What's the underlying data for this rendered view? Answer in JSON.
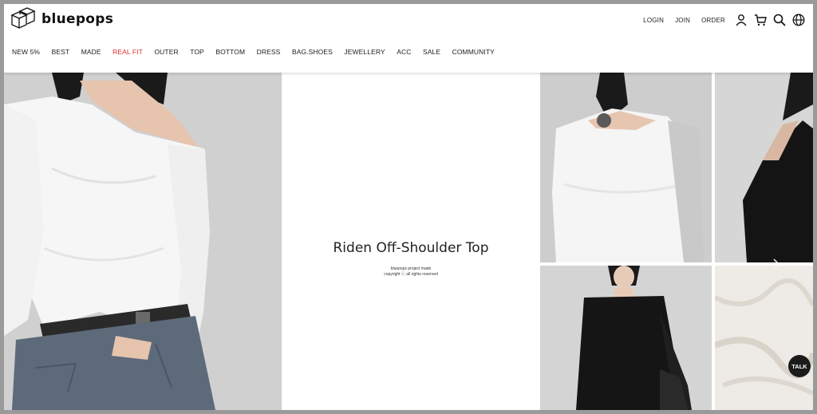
{
  "brand": {
    "name": "bluepops",
    "logo_icon": "cube-logo-icon"
  },
  "top_links": [
    "LOGIN",
    "JOIN",
    "ORDER"
  ],
  "top_icons": [
    "user-icon",
    "cart-icon",
    "search-icon",
    "globe-icon"
  ],
  "main_nav": [
    {
      "label": "NEW 5%"
    },
    {
      "label": "BEST"
    },
    {
      "label": "MADE"
    },
    {
      "label": "REAL FIT",
      "color": "#e03030"
    },
    {
      "label": "OUTER"
    },
    {
      "label": "TOP"
    },
    {
      "label": "BOTTOM"
    },
    {
      "label": "DRESS"
    },
    {
      "label": "BAG.SHOES"
    },
    {
      "label": "JEWELLERY"
    },
    {
      "label": "ACC"
    },
    {
      "label": "SALE"
    },
    {
      "label": "COMMUNITY"
    }
  ],
  "feature": {
    "title": "Riden Off-Shoulder Top",
    "credit_line1": "bluepops project made",
    "credit_line2": "copyright ⓒ all rights reserved"
  },
  "chat": {
    "label": "TALK"
  },
  "colors": {
    "accent_red": "#e03030",
    "chat_bg": "#1b1b1b"
  }
}
